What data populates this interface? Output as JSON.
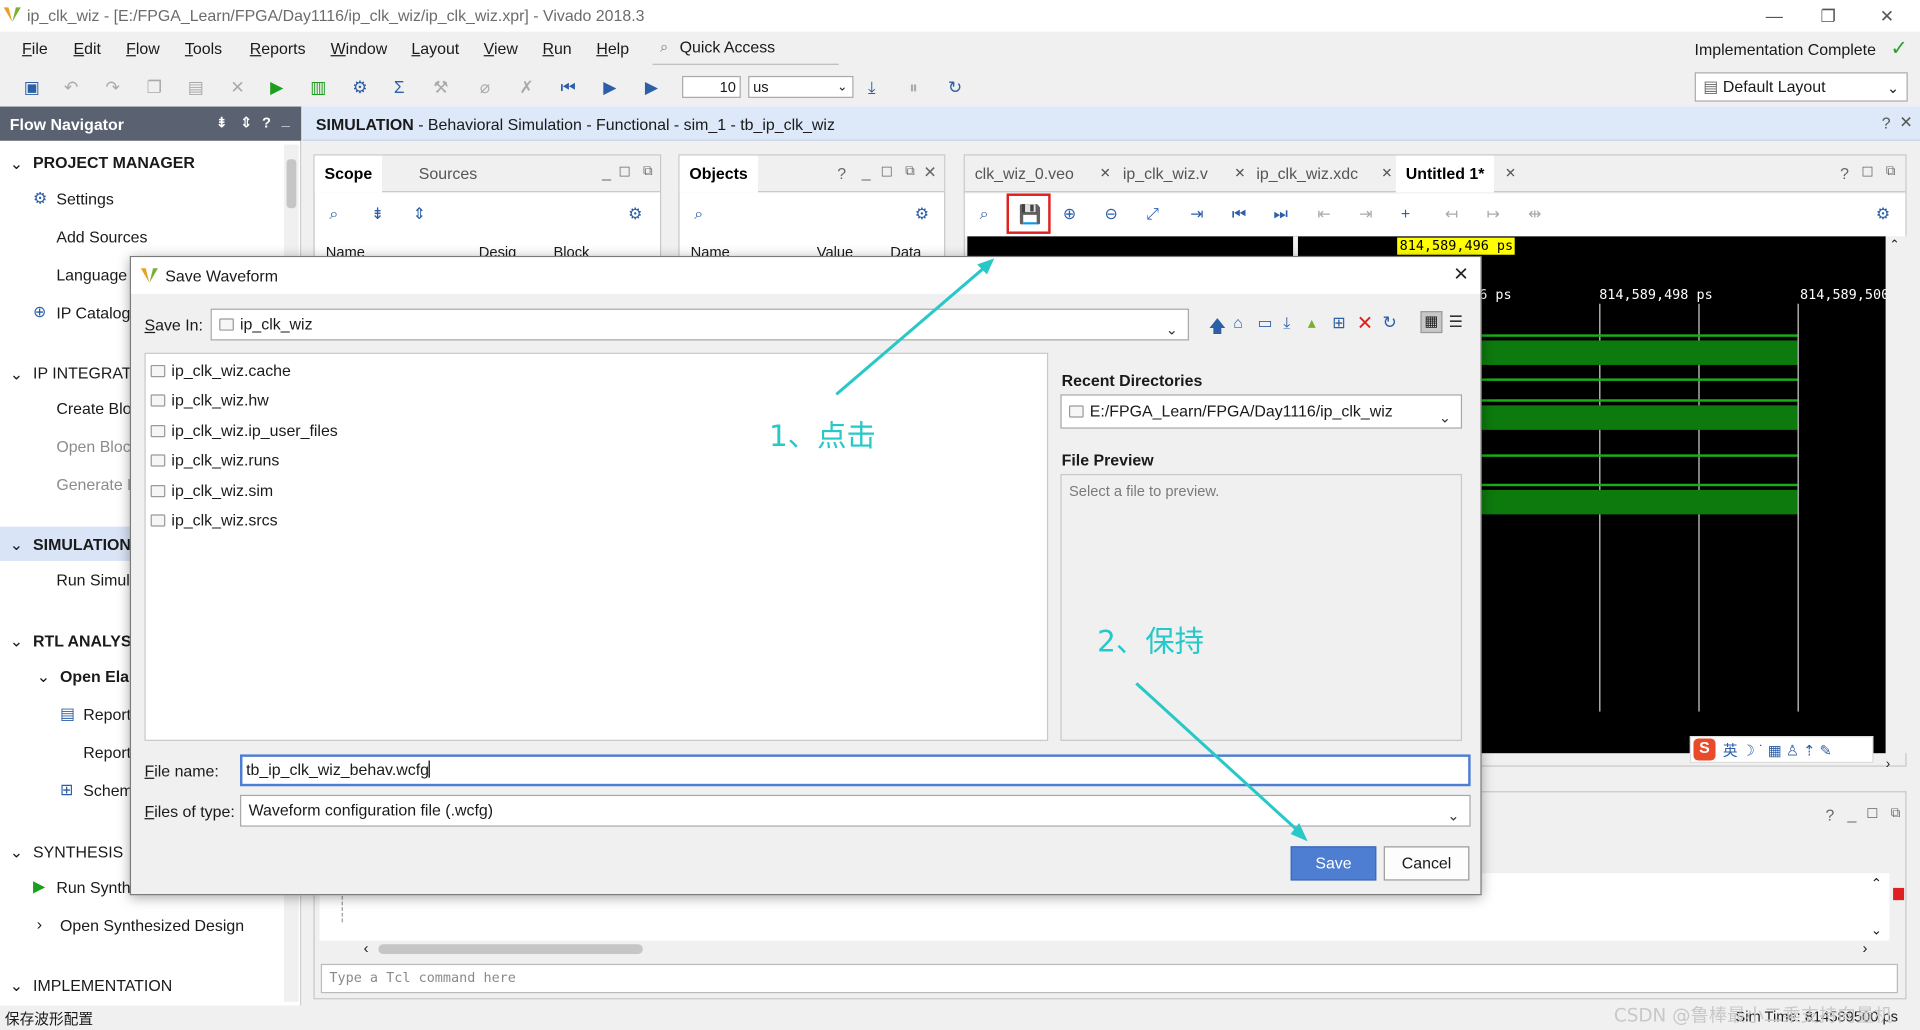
{
  "window": {
    "title": "ip_clk_wiz - [E:/FPGA_Learn/FPGA/Day1116/ip_clk_wiz/ip_clk_wiz.xpr] - Vivado 2018.3"
  },
  "menu": [
    "File",
    "Edit",
    "Flow",
    "Tools",
    "Reports",
    "Window",
    "Layout",
    "View",
    "Run",
    "Help"
  ],
  "quick_access": "Quick Access",
  "status_right": "Implementation Complete",
  "toolbar": {
    "time_value": "10",
    "time_unit": "us",
    "layout": "Default Layout"
  },
  "flow_navigator": {
    "title": "Flow Navigator",
    "sections": {
      "project_manager": "PROJECT MANAGER",
      "settings": "Settings",
      "add_sources": "Add Sources",
      "language": "Language T",
      "ip_catalog": "IP Catalog",
      "ip_integrator": "IP INTEGRATO",
      "create_block": "Create Bloc",
      "open_block": "Open Block",
      "generate_block": "Generate B",
      "simulation": "SIMULATION",
      "run_sim": "Run Simula",
      "rtl_analysis": "RTL ANALYSI",
      "open_elab": "Open Elab",
      "report1": "Report",
      "report2": "Report",
      "schem": "Schem",
      "synthesis": "SYNTHESIS",
      "run_synth": "Run Synthe",
      "open_synth": "Open Synthesized Design",
      "implementation": "IMPLEMENTATION"
    }
  },
  "sim_header": {
    "bold": "SIMULATION",
    "rest": " - Behavioral Simulation - Functional - sim_1 - tb_ip_clk_wiz"
  },
  "scope_panel": {
    "tabs": [
      "Scope",
      "Sources"
    ],
    "cols": [
      "Name",
      "Desig",
      "Block"
    ]
  },
  "objects_panel": {
    "title": "Objects",
    "cols": [
      "Name",
      "Value",
      "Data"
    ]
  },
  "wave_panel": {
    "tabs": [
      "clk_wiz_0.veo",
      "ip_clk_wiz.v",
      "ip_clk_wiz.xdc",
      "Untitled 1*"
    ],
    "cursor": "814,589,496 ps",
    "ticks": [
      "6 ps",
      "814,589,498 ps",
      "814,589,500"
    ]
  },
  "tcl": {
    "placeholder": "Type a Tcl command here"
  },
  "statusbar": {
    "left": "保存波形配置",
    "right": "Sim Time: 814589500 ps",
    "watermark": "CSDN @鲁棒最小二乘支持向量机"
  },
  "dialog": {
    "title": "Save Waveform",
    "save_in_label": "Save In:",
    "save_in_value": "ip_clk_wiz",
    "files": [
      "ip_clk_wiz.cache",
      "ip_clk_wiz.hw",
      "ip_clk_wiz.ip_user_files",
      "ip_clk_wiz.runs",
      "ip_clk_wiz.sim",
      "ip_clk_wiz.srcs"
    ],
    "recent_label": "Recent Directories",
    "recent_value": "E:/FPGA_Learn/FPGA/Day1116/ip_clk_wiz",
    "preview_label": "File Preview",
    "preview_text": "Select a file to preview.",
    "filename_label": "File name:",
    "filename_value": "tb_ip_clk_wiz_behav.wcfg",
    "filetype_label": "Files of type:",
    "filetype_value": "Waveform configuration file (.wcfg)",
    "save_btn": "Save",
    "cancel_btn": "Cancel"
  },
  "annotations": {
    "step1": "1、点击",
    "step2": "2、保持"
  },
  "colors": {
    "accent": "#4e7ed2",
    "annotation": "#29c8c8",
    "wave_green": "#0d7a0d",
    "highlight_box": "#e02020"
  }
}
